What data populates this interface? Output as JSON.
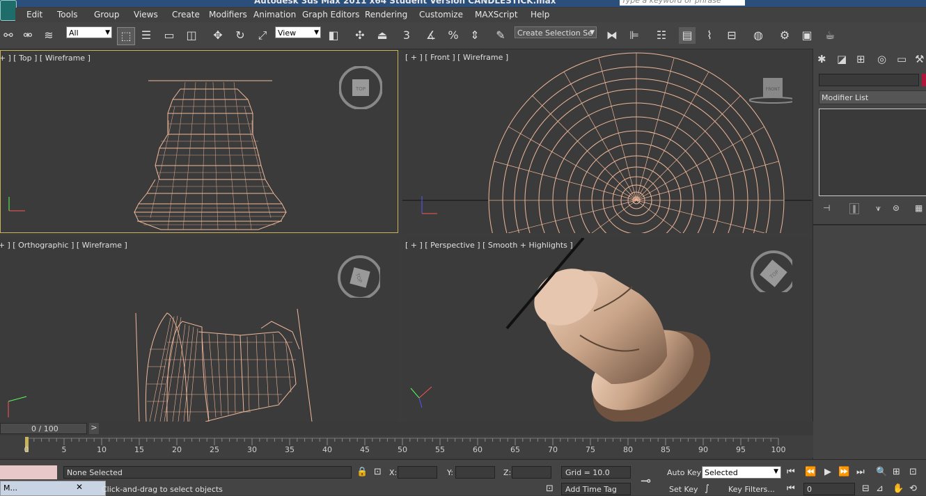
{
  "window": {
    "title": "Autodesk 3ds Max  2011 x64    Student Version    CANDLESTICK.max",
    "search_placeholder": "Type a keyword or phrase"
  },
  "menu": [
    "Edit",
    "Tools",
    "Group",
    "Views",
    "Create",
    "Modifiers",
    "Animation",
    "Graph Editors",
    "Rendering",
    "Customize",
    "MAXScript",
    "Help"
  ],
  "toolbar": {
    "selection_filter": "All",
    "reference_coord": "View",
    "selection_set": "Create Selection Se",
    "snap_number": "3"
  },
  "viewports": {
    "top": {
      "label": "[ + ] [ Top ] [ Wireframe ]",
      "cube_text": "TOP"
    },
    "front": {
      "label": "[ + ] [ Front ] [ Wireframe ]",
      "cube_text": "FRONT"
    },
    "ortho": {
      "label": "[ + ] [ Orthographic ] [ Wireframe ]",
      "cube_text": "TOP"
    },
    "persp": {
      "label": "[ + ] [ Perspective ] [ Smooth + Highlights ]",
      "cube_text": "TOP"
    }
  },
  "command_panel": {
    "modifier_list": "Modifier List"
  },
  "timeline": {
    "frame_counter": "0 / 100",
    "next": ">",
    "ticks": [
      "0",
      "5",
      "10",
      "15",
      "20",
      "25",
      "30",
      "35",
      "40",
      "45",
      "50",
      "55",
      "60",
      "65",
      "70",
      "75",
      "80",
      "85",
      "90",
      "95",
      "100"
    ]
  },
  "status": {
    "selection": "None Selected",
    "prompt": "Click-and-drag to select objects",
    "x_label": "X:",
    "y_label": "Y:",
    "z_label": "Z:",
    "grid": "Grid = 10.0",
    "add_time_tag": "Add Time Tag",
    "auto_key": "Auto Key",
    "set_key": "Set Key",
    "key_mode": "Selected",
    "key_filters": "Key Filters...",
    "current_frame": "0",
    "taskbar_item": "M..."
  },
  "colors": {
    "wire": "#f0b89a",
    "viewport_bg": "#3b3b3b",
    "active_border": "#c8b45a"
  }
}
